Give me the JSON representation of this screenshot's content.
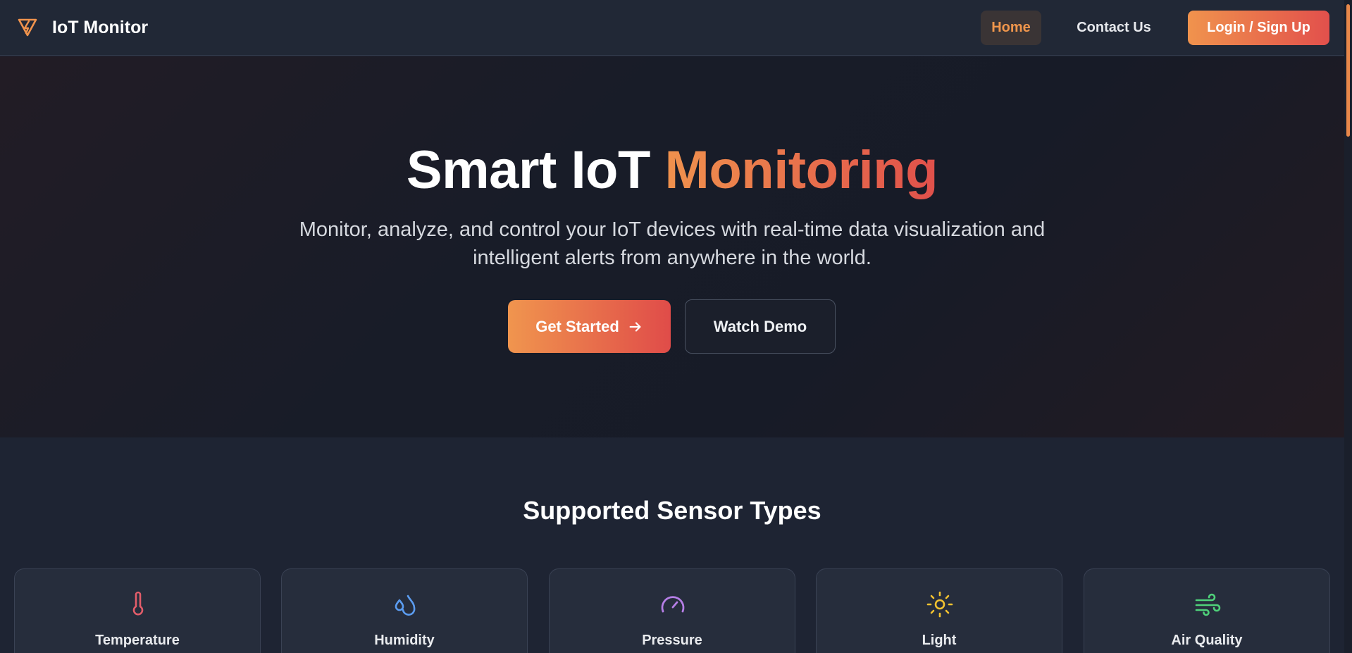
{
  "header": {
    "brand": "IoT Monitor",
    "nav": {
      "home": "Home",
      "contact": "Contact Us",
      "login": "Login / Sign Up"
    }
  },
  "hero": {
    "title_main": "Smart IoT ",
    "title_accent": "Monitoring",
    "subtitle_line1": "Monitor, analyze, and control your IoT devices with real-time data visualization and",
    "subtitle_line2": "intelligent alerts from anywhere in the world.",
    "primary_button": "Get Started",
    "secondary_button": "Watch Demo"
  },
  "sensors": {
    "title": "Supported Sensor Types",
    "items": [
      {
        "label": "Temperature",
        "icon": "thermometer-icon",
        "color": "#e35d6a"
      },
      {
        "label": "Humidity",
        "icon": "droplets-icon",
        "color": "#5b9cf0"
      },
      {
        "label": "Pressure",
        "icon": "gauge-icon",
        "color": "#b57ee6"
      },
      {
        "label": "Light",
        "icon": "sun-icon",
        "color": "#f2c230"
      },
      {
        "label": "Air Quality",
        "icon": "wind-icon",
        "color": "#4fd17a"
      }
    ]
  },
  "colors": {
    "accent_start": "#f0934d",
    "accent_end": "#e2504c",
    "background": "#1e2433"
  }
}
